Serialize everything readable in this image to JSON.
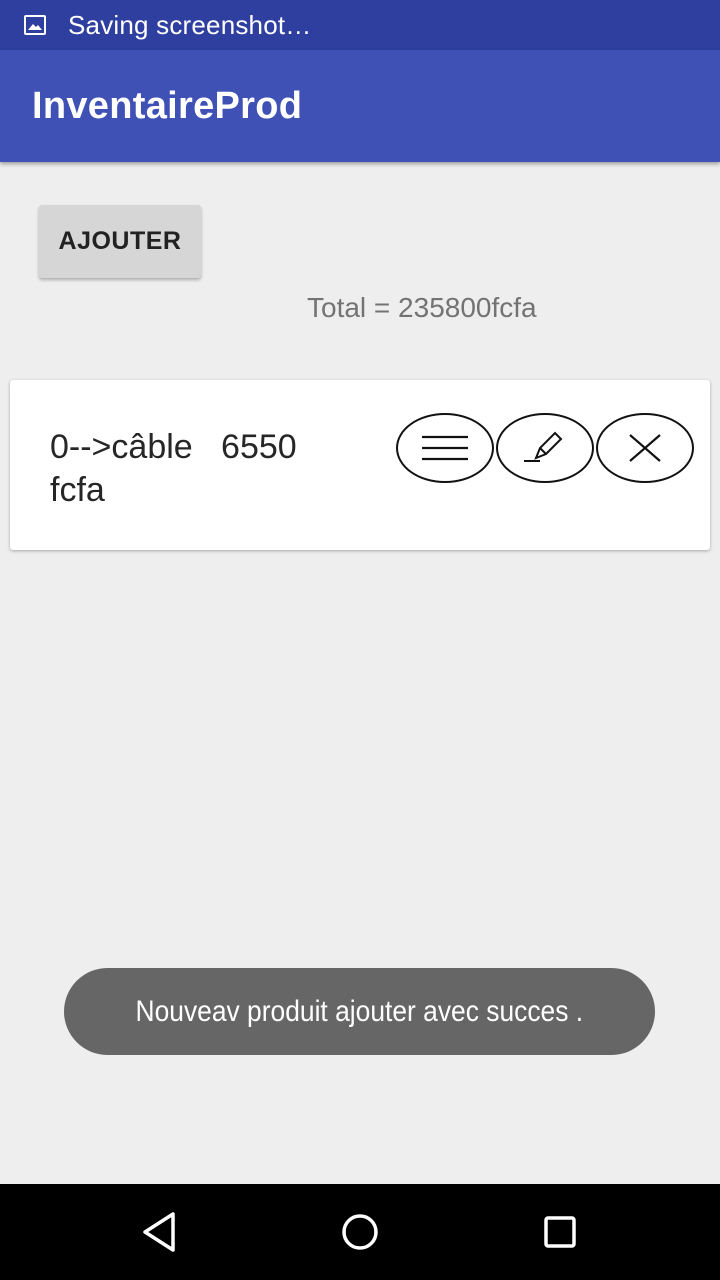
{
  "status_bar": {
    "icon": "image-icon",
    "text": "Saving screenshot…"
  },
  "app_bar": {
    "title": "InventaireProd",
    "color": "#3f51b5"
  },
  "main": {
    "add_button_label": "AJOUTER",
    "total_text": "Total = 235800fcfa",
    "products": [
      {
        "label": "0-->câble   6550 fcfa",
        "actions": [
          "menu-icon",
          "edit-pencil-icon",
          "close-icon"
        ]
      }
    ]
  },
  "toast": {
    "text": "Nouveav produit ajouter avec succes ."
  },
  "nav_bar": {
    "buttons": [
      "back-icon",
      "home-icon",
      "recents-icon"
    ]
  }
}
